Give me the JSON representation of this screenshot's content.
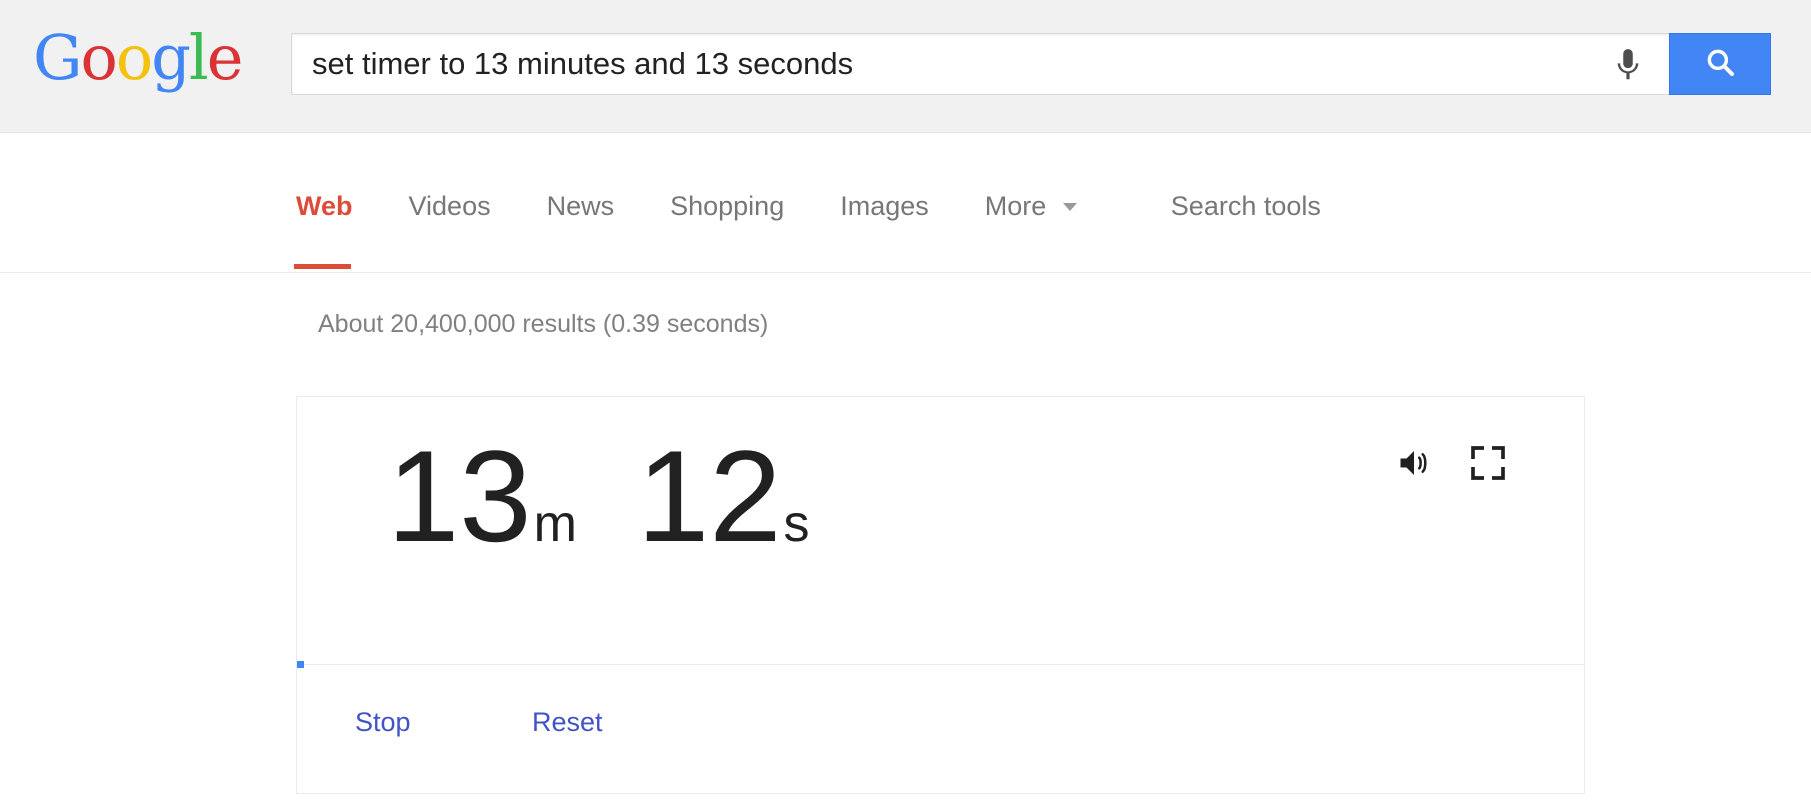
{
  "logo": {
    "letters": [
      {
        "char": "G",
        "color": "#4285f4"
      },
      {
        "char": "o",
        "color": "#db3236"
      },
      {
        "char": "o",
        "color": "#f4c20d"
      },
      {
        "char": "g",
        "color": "#4285f4"
      },
      {
        "char": "l",
        "color": "#3cba54"
      },
      {
        "char": "e",
        "color": "#db3236"
      }
    ],
    "text": "Google"
  },
  "search": {
    "value": "set timer to 13 minutes and 13 seconds",
    "placeholder": "Search",
    "mic_icon": "microphone-icon",
    "submit_icon": "search-icon",
    "submit_color": "#4285f4"
  },
  "nav": {
    "tabs": [
      {
        "label": "Web",
        "active": true
      },
      {
        "label": "Videos",
        "active": false
      },
      {
        "label": "News",
        "active": false
      },
      {
        "label": "Shopping",
        "active": false
      },
      {
        "label": "Images",
        "active": false
      },
      {
        "label": "More",
        "active": false,
        "has_caret": true
      }
    ],
    "search_tools": "Search tools",
    "active_color": "#dd4b39"
  },
  "results": {
    "stats": "About 20,400,000 results (0.39 seconds)"
  },
  "timer": {
    "minutes": "13",
    "minutes_unit": "m",
    "seconds": "12",
    "seconds_unit": "s",
    "target_minutes": 13,
    "target_seconds": 13,
    "remaining_display": "13m 12s",
    "sound_icon": "volume-icon",
    "fullscreen_icon": "fullscreen-icon",
    "progress_color": "#4285f4",
    "actions": {
      "stop": "Stop",
      "reset": "Reset",
      "link_color": "#4253c5"
    }
  }
}
